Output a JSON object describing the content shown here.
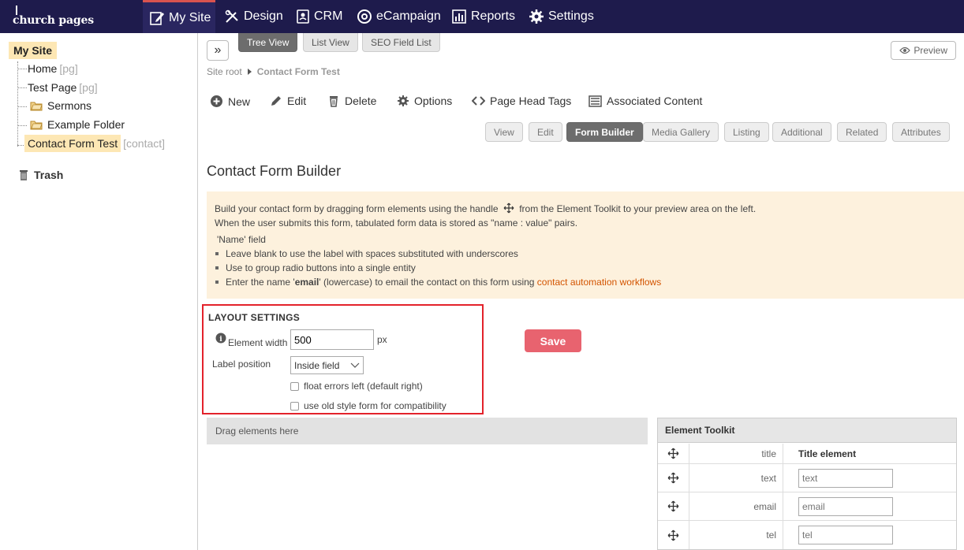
{
  "app": {
    "logo": "church pages"
  },
  "nav": [
    {
      "label": "My Site",
      "icon": "edit-page-icon"
    },
    {
      "label": "Design",
      "icon": "design-tools-icon"
    },
    {
      "label": "CRM",
      "icon": "contacts-icon"
    },
    {
      "label": "eCampaign",
      "icon": "at-sign-icon"
    },
    {
      "label": "Reports",
      "icon": "bar-chart-icon"
    },
    {
      "label": "Settings",
      "icon": "gear-icon"
    }
  ],
  "tree": {
    "root": "My Site",
    "items": [
      {
        "label": "Home",
        "tag": "[pg]"
      },
      {
        "label": "Test Page",
        "tag": "[pg]"
      },
      {
        "label": "Sermons",
        "tag": ""
      },
      {
        "label": "Example Folder",
        "tag": ""
      },
      {
        "label": "Contact Form Test",
        "tag": "[contact]"
      }
    ],
    "trash": "Trash"
  },
  "view_tabs": [
    "Tree View",
    "List View",
    "SEO Field List"
  ],
  "preview": "Preview",
  "breadcrumb": {
    "root": "Site root",
    "current": "Contact Form Test"
  },
  "actions": [
    "New",
    "Edit",
    "Delete",
    "Options",
    "Page Head Tags",
    "Associated Content"
  ],
  "sub_tabs": [
    "View",
    "Edit",
    "Form Builder",
    "Media Gallery",
    "Listing",
    "Additional",
    "Related",
    "Attributes"
  ],
  "heading": "Contact Form Builder",
  "info": {
    "line1a": "Build your contact form by dragging form elements using the handle",
    "line1b": "from the Element Toolkit to your preview area on the left.",
    "line2": "When the user submits this form, tabulated form data is stored as \"name : value\" pairs.",
    "field_title": "'Name' field",
    "bullet1": "Leave blank to use the label with spaces substituted with underscores",
    "bullet2": "Use to group radio buttons into a single entity",
    "bullet3a": "Enter the name '",
    "bullet3b": "email",
    "bullet3c": "' (lowercase) to email the contact on this form using ",
    "bullet3link": "contact automation workflows"
  },
  "layout": {
    "title": "LAYOUT SETTINGS",
    "width_label": "Element width",
    "width_value": "500",
    "width_unit": "px",
    "position_label": "Label position",
    "position_value": "Inside field",
    "chk1": "float errors left (default right)",
    "chk2": "use old style form for compatibility"
  },
  "save": "Save",
  "drop_zone": "Drag elements here",
  "toolkit": {
    "title": "Element Toolkit",
    "rows": [
      {
        "key": "title",
        "value": "Title element"
      },
      {
        "key": "text",
        "value": "text"
      },
      {
        "key": "email",
        "value": "email"
      },
      {
        "key": "tel",
        "value": "tel"
      }
    ]
  }
}
